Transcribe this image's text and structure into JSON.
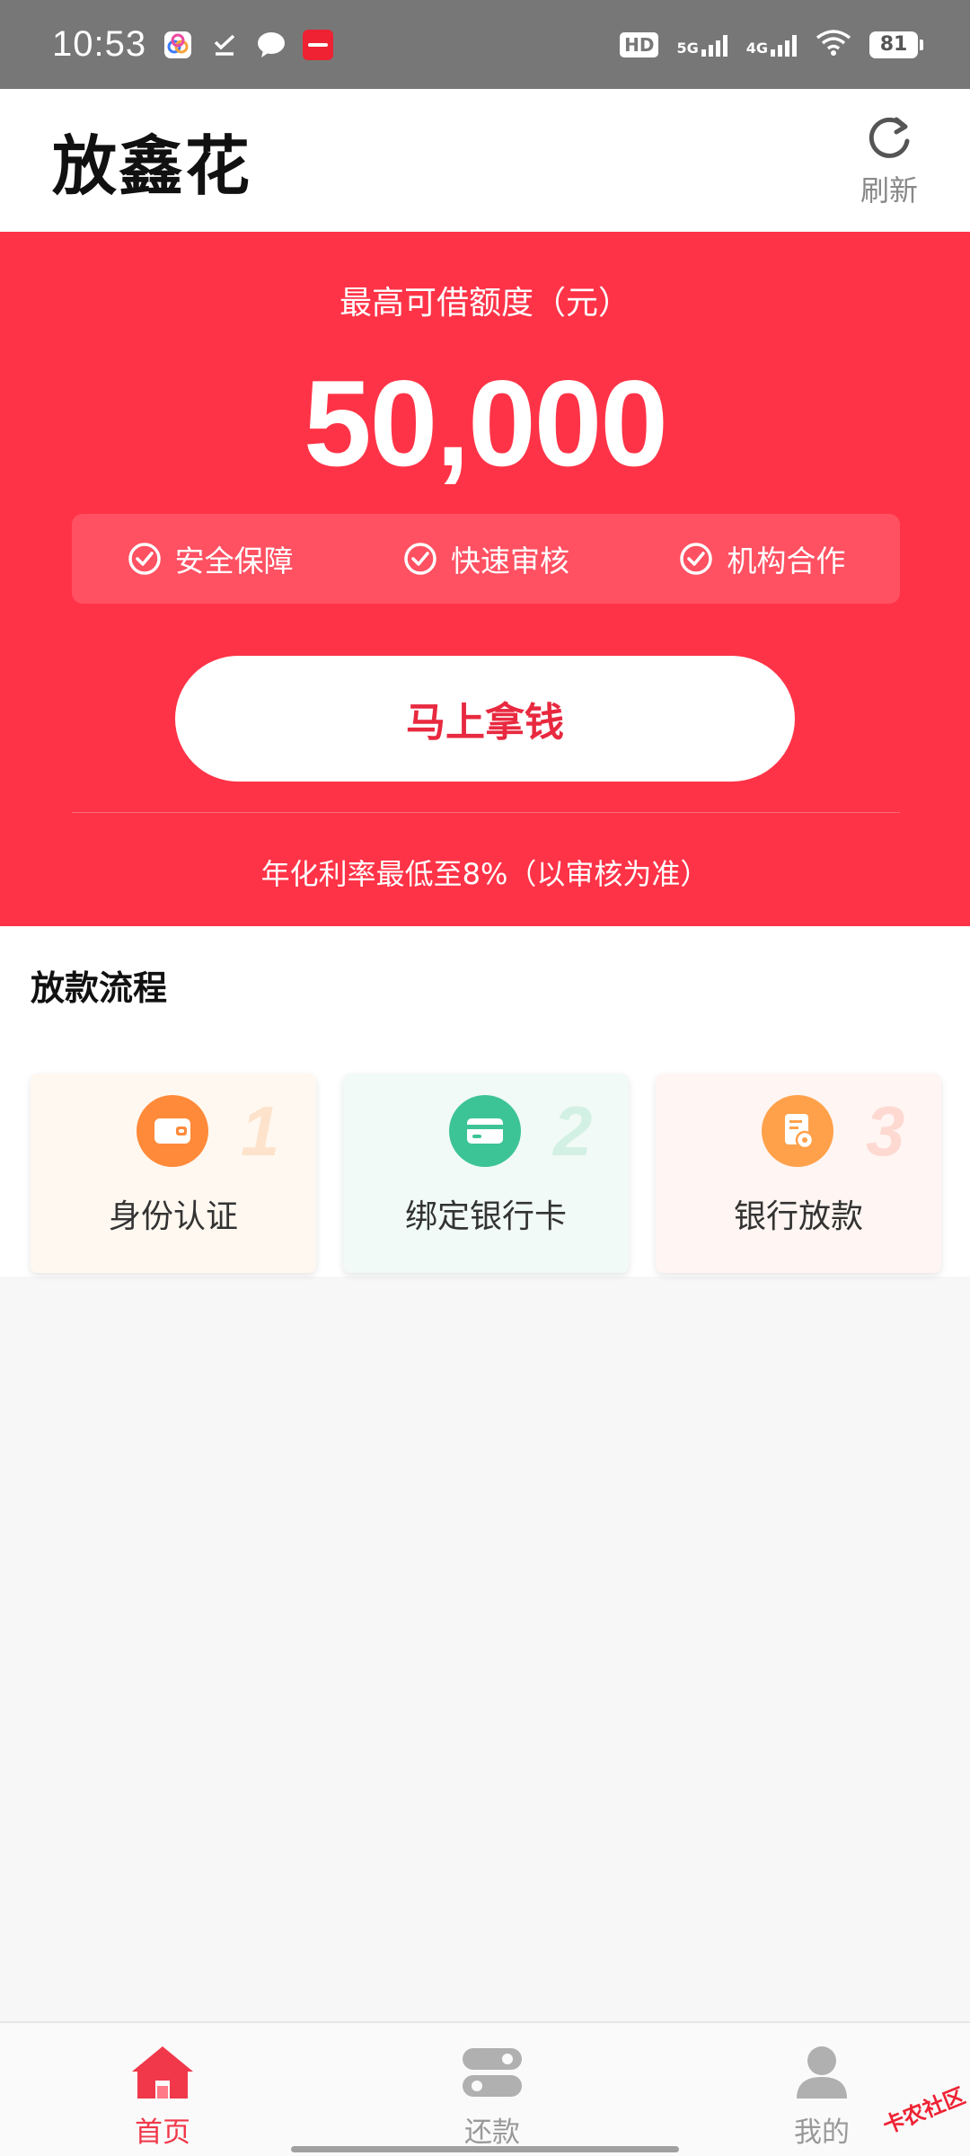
{
  "status_bar": {
    "time": "10:53",
    "network_5g": "5G",
    "network_4g": "4G",
    "battery": "81",
    "hd_label": "HD"
  },
  "header": {
    "title": "放鑫花",
    "refresh_label": "刷新"
  },
  "hero": {
    "caption": "最高可借额度（元）",
    "amount": "50,000",
    "features": [
      "安全保障",
      "快速审核",
      "机构合作"
    ],
    "cta_label": "马上拿钱",
    "footnote": "年化利率最低至8%（以审核为准）"
  },
  "process": {
    "title": "放款流程",
    "steps": [
      {
        "num": "1",
        "label": "身份认证",
        "icon": "wallet-icon"
      },
      {
        "num": "2",
        "label": "绑定银行卡",
        "icon": "bank-card-icon"
      },
      {
        "num": "3",
        "label": "银行放款",
        "icon": "loan-document-icon"
      }
    ]
  },
  "bottom_nav": {
    "items": [
      {
        "label": "首页",
        "icon": "home-icon",
        "active": true
      },
      {
        "label": "还款",
        "icon": "repay-icon",
        "active": false
      },
      {
        "label": "我的",
        "icon": "profile-icon",
        "active": false
      }
    ]
  },
  "watermark": "卡农社区",
  "colors": {
    "brand_red": "#ff3347",
    "cta_text": "#e8293f",
    "nav_active": "#f0384a",
    "step1_icon": "#ff8a3a",
    "step2_icon": "#3dc496",
    "step3_icon": "#ffa14a"
  }
}
